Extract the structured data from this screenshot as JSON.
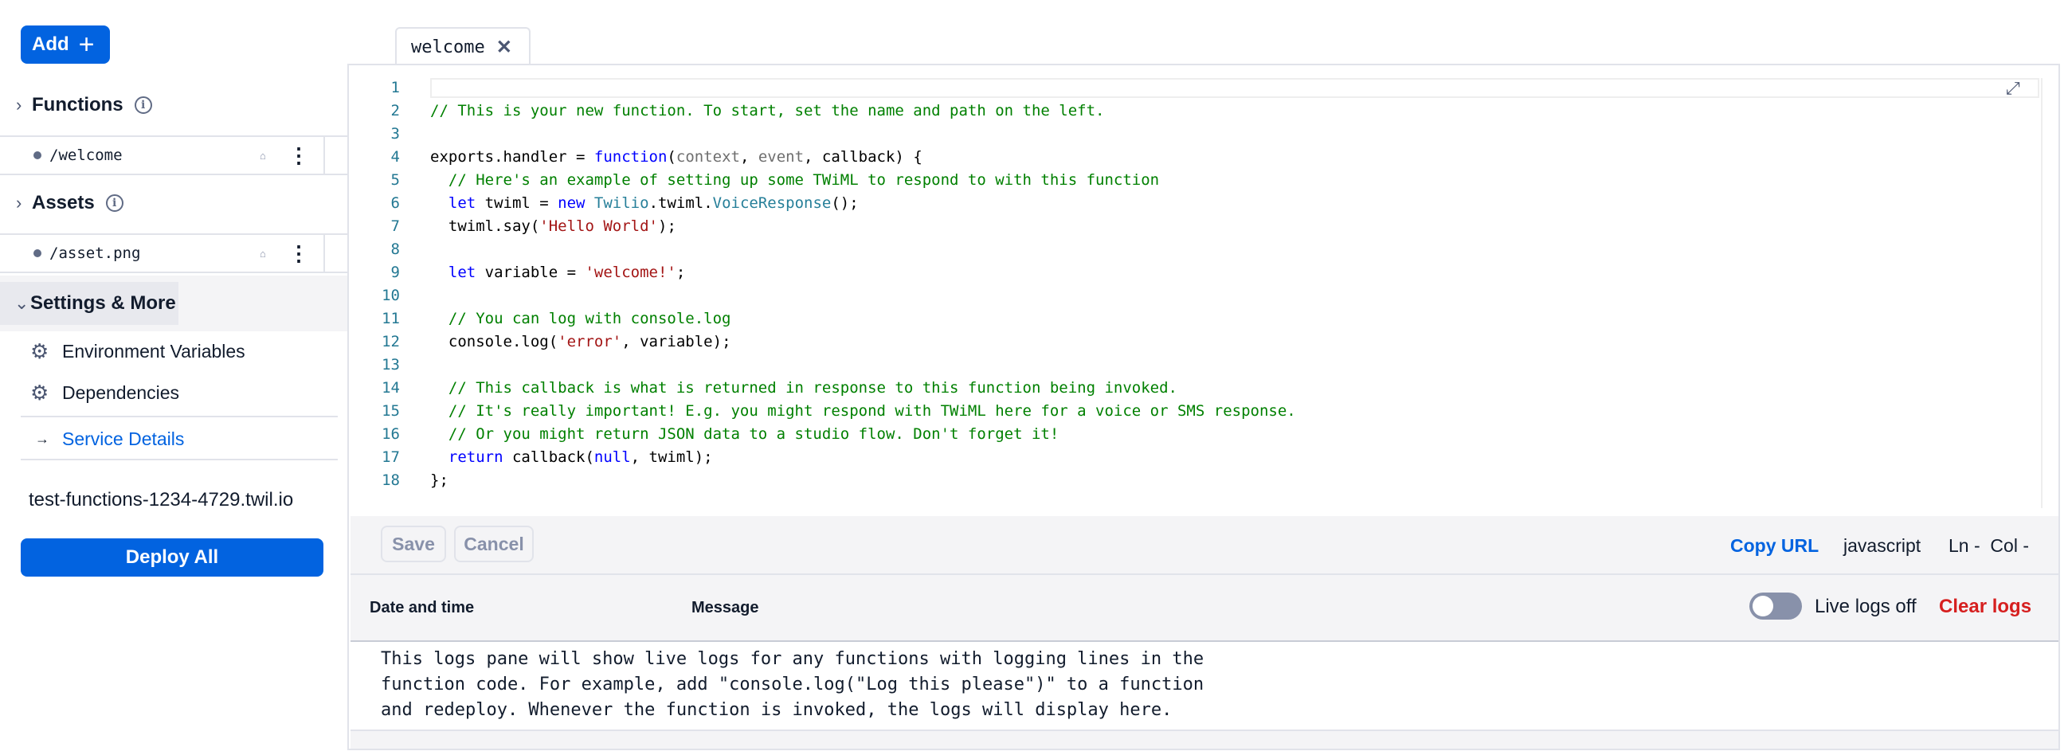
{
  "sidebar": {
    "add_label": "Add",
    "add_icon": "+",
    "functions": {
      "title": "Functions",
      "items": [
        {
          "path": "/welcome"
        }
      ]
    },
    "assets": {
      "title": "Assets",
      "items": [
        {
          "path": "/asset.png"
        }
      ]
    },
    "settings": {
      "title": "Settings & More",
      "items": [
        {
          "label": "Environment Variables",
          "icon": "gear-icon"
        },
        {
          "label": "Dependencies",
          "icon": "gear-icon"
        }
      ],
      "service_details": "Service Details"
    },
    "domain": "test-functions-1234-4729.twil.io",
    "deploy_label": "Deploy All"
  },
  "editor": {
    "tab_label": "welcome",
    "line_numbers": [
      "1",
      "2",
      "3",
      "4",
      "5",
      "6",
      "7",
      "8",
      "9",
      "10",
      "11",
      "12",
      "13",
      "14",
      "15",
      "16",
      "17",
      "18"
    ],
    "code": {
      "l2": "// This is your new function. To start, set the name and path on the left.",
      "l4_a": "exports.handler = ",
      "l4_b": "function",
      "l4_c": "(",
      "l4_d": "context",
      "l4_e": ", ",
      "l4_f": "event",
      "l4_g": ", callback) {",
      "l5": "  // Here's an example of setting up some TWiML to respond to with this function",
      "l6_a": "  let",
      "l6_b": " twiml = ",
      "l6_c": "new",
      "l6_d": " Twilio",
      "l6_e": ".twiml.",
      "l6_f": "VoiceResponse",
      "l6_g": "();",
      "l7_a": "  twiml.say(",
      "l7_b": "'Hello World'",
      "l7_c": ");",
      "l9_a": "  let",
      "l9_b": " variable = ",
      "l9_c": "'welcome!'",
      "l9_d": ";",
      "l11": "  // You can log with console.log",
      "l12_a": "  console.log(",
      "l12_b": "'error'",
      "l12_c": ", variable);",
      "l14": "  // This callback is what is returned in response to this function being invoked.",
      "l15": "  // It's really important! E.g. you might respond with TWiML here for a voice or SMS response.",
      "l16": "  // Or you might return JSON data to a studio flow. Don't forget it!",
      "l17_a": "  return",
      "l17_b": " callback(",
      "l17_c": "null",
      "l17_d": ", twiml);",
      "l18": "};"
    }
  },
  "toolbar": {
    "save_label": "Save",
    "cancel_label": "Cancel",
    "copy_url_label": "Copy URL",
    "language": "javascript",
    "position": "Ln -  Col -"
  },
  "logs": {
    "col_datetime": "Date and time",
    "col_message": "Message",
    "live_label": "Live logs off",
    "clear_label": "Clear logs",
    "body": "This logs pane will show live logs for any functions with logging lines in the\nfunction code. For example, add \"console.log(\"Log this please\")\" to a function\nand redeploy. Whenever the function is invoked, the logs will display here."
  },
  "colors": {
    "accent": "#0263e0",
    "danger": "#d61f1f"
  }
}
